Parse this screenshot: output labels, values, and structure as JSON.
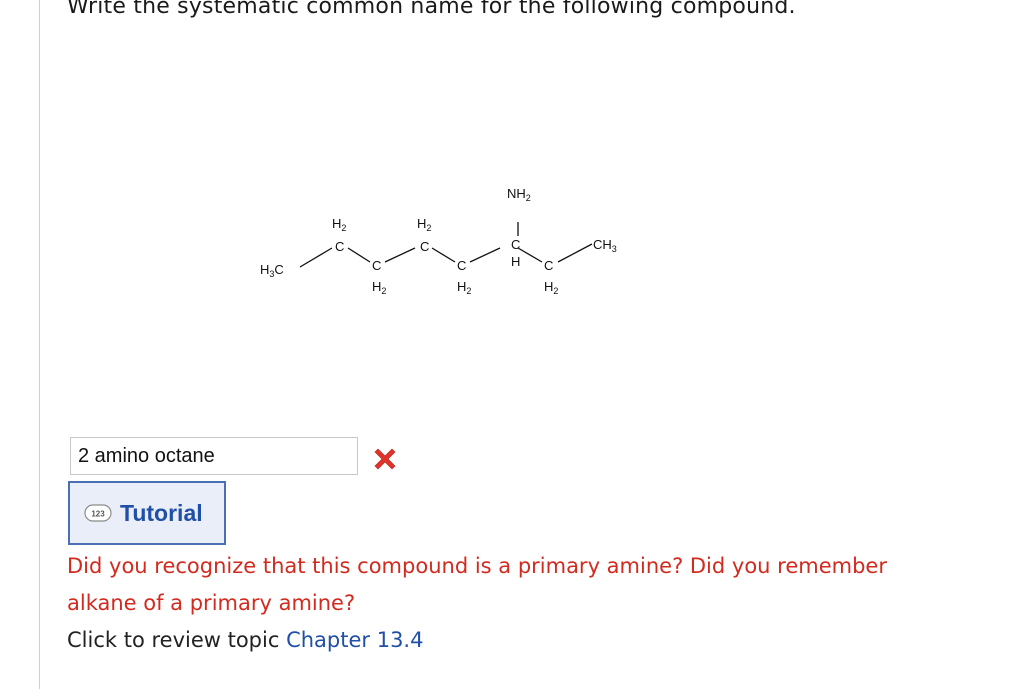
{
  "question": {
    "text": "Write the systematic common name for the following compound."
  },
  "structure": {
    "atoms": {
      "h3c": "H",
      "h3c_sub": "3",
      "h3c_c": "C",
      "ch2_label": "H",
      "ch2_sub": "2",
      "c": "C",
      "h": "H",
      "nh2_n": "NH",
      "nh2_sub": "2",
      "ch3_c": "CH",
      "ch3_sub": "3"
    }
  },
  "answer": {
    "value": "2 amino octane",
    "status_icon": "x-icon",
    "status_color": "#e0332a"
  },
  "tutorial": {
    "label": "Tutorial",
    "icon": "123"
  },
  "feedback": {
    "line1": "Did you recognize that this compound is a primary amine? Did you remember",
    "line2": "alkane of a primary amine?"
  },
  "review": {
    "prefix": "Click to review topic ",
    "link": "Chapter 13.4"
  },
  "colors": {
    "feedback": "#d32a1f",
    "link": "#1f4fa6",
    "tutorial_border": "#4a6fb3"
  }
}
